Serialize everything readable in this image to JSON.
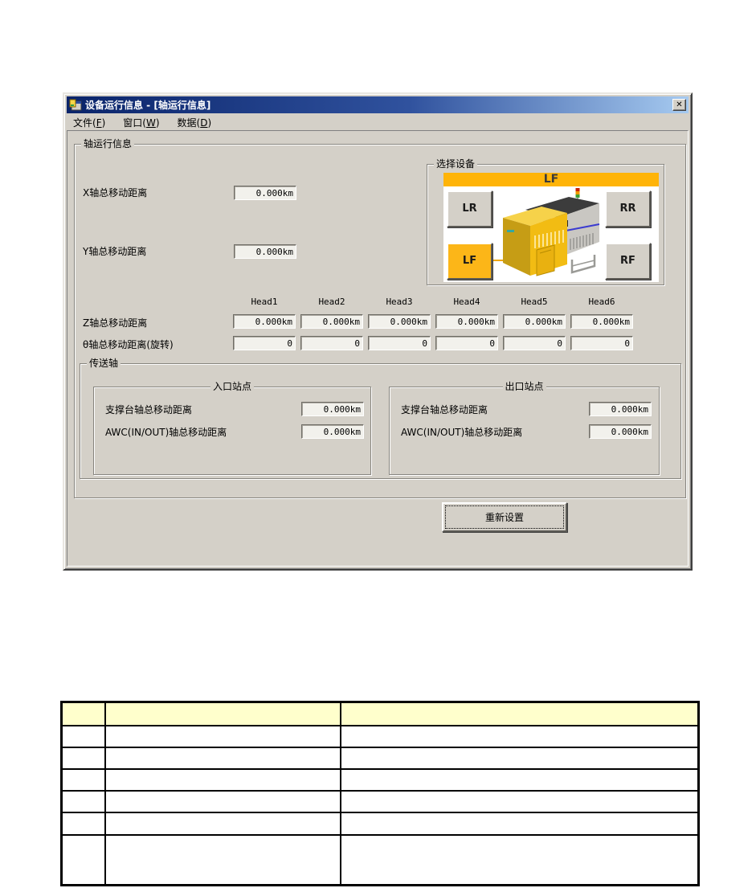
{
  "window": {
    "title": "设备运行信息 - [轴运行信息]",
    "close_glyph": "✕",
    "menu": [
      {
        "pre": "文件(",
        "accel": "F",
        "post": ")"
      },
      {
        "pre": "窗口(",
        "accel": "W",
        "post": ")"
      },
      {
        "pre": "数据(",
        "accel": "D",
        "post": ")"
      }
    ]
  },
  "axis_group": {
    "title": "轴运行信息",
    "x_axis_label": "X轴总移动距离",
    "x_axis_value": "0.000km",
    "y_axis_label": "Y轴总移动距离",
    "y_axis_value": "0.000km",
    "device_select": {
      "title": "选择设备",
      "selected": "LF",
      "button_lr": "LR",
      "button_rr": "RR",
      "button_lf": "LF",
      "button_rf": "RF"
    },
    "heads": {
      "labels": [
        "Head1",
        "Head2",
        "Head3",
        "Head4",
        "Head5",
        "Head6"
      ],
      "z_label": "Z轴总移动距离",
      "z_values": [
        "0.000km",
        "0.000km",
        "0.000km",
        "0.000km",
        "0.000km",
        "0.000km"
      ],
      "theta_label": "θ轴总移动距离(旋转)",
      "theta_values": [
        "0",
        "0",
        "0",
        "0",
        "0",
        "0"
      ]
    },
    "transfer": {
      "title": "传送轴",
      "entrance": {
        "title": "入口站点",
        "row1_label": "支撑台轴总移动距离",
        "row1_value": "0.000km",
        "row2_label": "AWC(IN/OUT)轴总移动距离",
        "row2_value": "0.000km"
      },
      "exit": {
        "title": "出口站点",
        "row1_label": "支撑台轴总移动距离",
        "row1_value": "0.000km",
        "row2_label": "AWC(IN/OUT)轴总移动距离",
        "row2_value": "0.000km"
      }
    },
    "reset_button": "重新设置"
  },
  "bottom_table": {
    "header": [
      "",
      "",
      ""
    ],
    "rows": [
      [
        "",
        "",
        ""
      ],
      [
        "",
        "",
        ""
      ],
      [
        "",
        "",
        ""
      ],
      [
        "",
        "",
        ""
      ],
      [
        "",
        "",
        ""
      ],
      [
        "",
        "",
        ""
      ]
    ]
  },
  "colors": {
    "titlebar_left": "#0A246A",
    "titlebar_right": "#A6CAF0",
    "dialog_bg": "#D4D0C8",
    "accent_gold": "#FFB408",
    "selected_button_gold": "#FCB618",
    "table_header_bg": "#FFFFCC"
  }
}
